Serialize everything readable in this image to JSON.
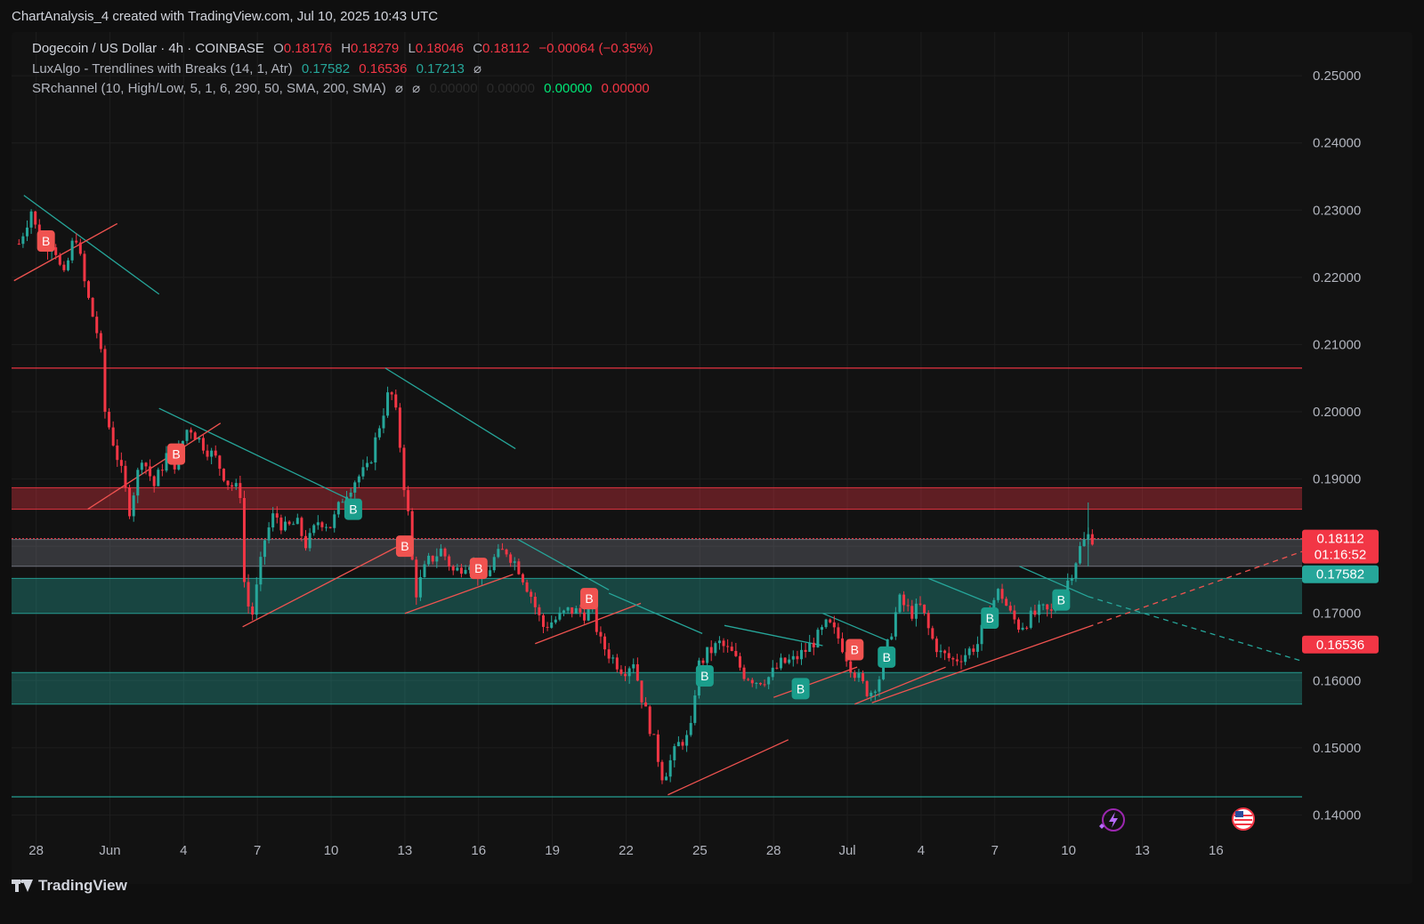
{
  "header": {
    "text": "ChartAnalysis_4 created with TradingView.com, Jul 10, 2025 10:43 UTC"
  },
  "legend": {
    "symbol": "Dogecoin / US Dollar · 4h · COINBASE",
    "o_label": "O",
    "o_value": "0.18176",
    "h_label": "H",
    "h_value": "0.18279",
    "l_label": "L",
    "l_value": "0.18046",
    "c_label": "C",
    "c_value": "0.18112",
    "change": "−0.00064 (−0.35%)",
    "ind1_name": "LuxAlgo - Trendlines with Breaks (14, 1, Atr)",
    "ind1_v1": "0.17582",
    "ind1_v2": "0.16536",
    "ind1_v3": "0.17213",
    "ind1_eye": "⌀",
    "ind2_name": "SRchannel (10, High/Low, 5, 1, 6, 290, 50, SMA, 200, SMA)",
    "ind2_eye1": "⌀",
    "ind2_eye2": "⌀",
    "ind2_v1": "0.00000",
    "ind2_v2": "0.00000",
    "ind2_v3": "0.00000",
    "ind2_v4": "0.00000"
  },
  "footer": {
    "brand": "TradingView"
  },
  "colors": {
    "up": "#26a69a",
    "down": "#f23645",
    "bg": "#121212",
    "grid": "#1e1e1e"
  },
  "chart_data": {
    "type": "candlestick",
    "symbol": "DOGEUSD",
    "interval": "4h",
    "ylim": [
      0.1345,
      0.2565
    ],
    "y_ticks": [
      "0.25000",
      "0.24000",
      "0.23000",
      "0.22000",
      "0.21000",
      "0.20000",
      "0.19000",
      "0.18000",
      "0.17000",
      "0.16000",
      "0.15000",
      "0.14000"
    ],
    "x_ticks": [
      "28",
      "Jun",
      "4",
      "7",
      "10",
      "13",
      "16",
      "19",
      "22",
      "25",
      "28",
      "Jul",
      "4",
      "7",
      "10",
      "13",
      "16"
    ],
    "x_tick_days": [
      -3,
      0,
      3,
      6,
      9,
      12,
      15,
      18,
      21,
      24,
      27,
      30,
      33,
      36,
      39,
      42,
      45
    ],
    "x_range_days": [
      -4,
      48.5
    ],
    "price_labels": [
      {
        "value": 0.18112,
        "text": "0.18112",
        "sub": "01:16:52",
        "color": "#f23645"
      },
      {
        "value": 0.17582,
        "text": "0.17582",
        "color": "#26a69a"
      },
      {
        "value": 0.16536,
        "text": "0.16536",
        "color": "#f23645"
      }
    ],
    "zones": [
      {
        "from": 0.1855,
        "to": 0.1887,
        "color": "#f23645"
      },
      {
        "from": 0.177,
        "to": 0.181,
        "color": "#787b86"
      },
      {
        "from": 0.17,
        "to": 0.1752,
        "color": "#26a69a"
      },
      {
        "from": 0.1565,
        "to": 0.1612,
        "color": "#26a69a"
      }
    ],
    "hlines": [
      {
        "value": 0.2065,
        "color": "#f23645"
      },
      {
        "value": 0.1427,
        "color": "#26a69a"
      }
    ],
    "trendlines": [
      {
        "kind": "resistance",
        "x1": -3.5,
        "y1": 0.2322,
        "x2": 2.0,
        "y2": 0.2175
      },
      {
        "kind": "support",
        "x1": -3.9,
        "y1": 0.2195,
        "x2": 0.3,
        "y2": 0.228
      },
      {
        "kind": "resistance",
        "x1": 2.0,
        "y1": 0.2005,
        "x2": 10.0,
        "y2": 0.1865
      },
      {
        "kind": "support",
        "x1": -0.9,
        "y1": 0.1855,
        "x2": 4.5,
        "y2": 0.1983
      },
      {
        "kind": "resistance",
        "x1": 11.2,
        "y1": 0.2065,
        "x2": 16.5,
        "y2": 0.1945
      },
      {
        "kind": "support",
        "x1": 5.4,
        "y1": 0.168,
        "x2": 12.0,
        "y2": 0.1805
      },
      {
        "kind": "support",
        "x1": 12.0,
        "y1": 0.17,
        "x2": 16.4,
        "y2": 0.1758
      },
      {
        "kind": "resistance",
        "x1": 16.6,
        "y1": 0.181,
        "x2": 20.3,
        "y2": 0.1735
      },
      {
        "kind": "support",
        "x1": 17.3,
        "y1": 0.1655,
        "x2": 21.6,
        "y2": 0.1715
      },
      {
        "kind": "resistance",
        "x1": 20.3,
        "y1": 0.173,
        "x2": 24.1,
        "y2": 0.167
      },
      {
        "kind": "support",
        "x1": 22.7,
        "y1": 0.143,
        "x2": 27.6,
        "y2": 0.1512
      },
      {
        "kind": "resistance",
        "x1": 25.0,
        "y1": 0.1682,
        "x2": 29.0,
        "y2": 0.1652
      },
      {
        "kind": "support",
        "x1": 27.0,
        "y1": 0.1575,
        "x2": 30.4,
        "y2": 0.162
      },
      {
        "kind": "resistance",
        "x1": 29.0,
        "y1": 0.17,
        "x2": 31.6,
        "y2": 0.166
      },
      {
        "kind": "support",
        "x1": 30.3,
        "y1": 0.1565,
        "x2": 34.0,
        "y2": 0.162
      },
      {
        "kind": "resistance",
        "x1": 33.3,
        "y1": 0.1752,
        "x2": 36.0,
        "y2": 0.1712
      },
      {
        "kind": "support",
        "x1": 31.0,
        "y1": 0.1567,
        "x2": 39.8,
        "y2": 0.168
      },
      {
        "kind": "resistance",
        "x1": 37.0,
        "y1": 0.177,
        "x2": 39.8,
        "y2": 0.1725
      }
    ],
    "projections": [
      {
        "kind": "support",
        "x1": 39.8,
        "y1": 0.168,
        "x2": 48.5,
        "y2": 0.1792
      },
      {
        "kind": "resistance",
        "x1": 39.8,
        "y1": 0.1725,
        "x2": 48.5,
        "y2": 0.1629
      }
    ],
    "break_markers": [
      {
        "day": -2.6,
        "price": 0.2254,
        "side": "sell",
        "text": "B"
      },
      {
        "day": 2.7,
        "price": 0.1937,
        "side": "sell",
        "text": "B"
      },
      {
        "day": 9.9,
        "price": 0.1855,
        "side": "buy",
        "text": "B"
      },
      {
        "day": 12.0,
        "price": 0.18,
        "side": "sell",
        "text": "B"
      },
      {
        "day": 15.0,
        "price": 0.1767,
        "side": "sell",
        "text": "B"
      },
      {
        "day": 19.5,
        "price": 0.1722,
        "side": "sell",
        "text": "B"
      },
      {
        "day": 24.2,
        "price": 0.1607,
        "side": "buy",
        "text": "B"
      },
      {
        "day": 28.1,
        "price": 0.1588,
        "side": "buy",
        "text": "B"
      },
      {
        "day": 30.3,
        "price": 0.1646,
        "side": "sell",
        "text": "B"
      },
      {
        "day": 31.6,
        "price": 0.1635,
        "side": "buy",
        "text": "B"
      },
      {
        "day": 35.8,
        "price": 0.1693,
        "side": "buy",
        "text": "B"
      },
      {
        "day": 38.7,
        "price": 0.172,
        "side": "buy",
        "text": "B"
      }
    ],
    "price_path": [
      [
        -3.7,
        0.225
      ],
      [
        -3.2,
        0.23
      ],
      [
        -2.8,
        0.224
      ],
      [
        -2.3,
        0.2255
      ],
      [
        -1.9,
        0.2195
      ],
      [
        -1.4,
        0.2268
      ],
      [
        -1.0,
        0.2185
      ],
      [
        -0.4,
        0.21
      ],
      [
        -0.2,
        0.2
      ],
      [
        0.4,
        0.192
      ],
      [
        0.8,
        0.1855
      ],
      [
        1.3,
        0.1935
      ],
      [
        1.8,
        0.189
      ],
      [
        2.3,
        0.1935
      ],
      [
        2.6,
        0.192
      ],
      [
        3.2,
        0.198
      ],
      [
        3.7,
        0.1955
      ],
      [
        4.3,
        0.193
      ],
      [
        4.8,
        0.1895
      ],
      [
        5.3,
        0.188
      ],
      [
        5.5,
        0.172
      ],
      [
        5.8,
        0.17
      ],
      [
        6.3,
        0.181
      ],
      [
        6.7,
        0.185
      ],
      [
        7.1,
        0.1825
      ],
      [
        7.6,
        0.1835
      ],
      [
        8.0,
        0.18
      ],
      [
        8.5,
        0.184
      ],
      [
        9.0,
        0.183
      ],
      [
        9.5,
        0.1875
      ],
      [
        10.0,
        0.19
      ],
      [
        10.5,
        0.1915
      ],
      [
        11.0,
        0.1985
      ],
      [
        11.4,
        0.2035
      ],
      [
        11.7,
        0.1985
      ],
      [
        12.0,
        0.188
      ],
      [
        12.2,
        0.183
      ],
      [
        12.4,
        0.1725
      ],
      [
        12.9,
        0.1775
      ],
      [
        13.5,
        0.1795
      ],
      [
        14.0,
        0.176
      ],
      [
        14.6,
        0.178
      ],
      [
        15.2,
        0.1745
      ],
      [
        15.6,
        0.178
      ],
      [
        16.1,
        0.1795
      ],
      [
        16.6,
        0.177
      ],
      [
        17.1,
        0.173
      ],
      [
        17.6,
        0.168
      ],
      [
        18.1,
        0.169
      ],
      [
        18.7,
        0.1705
      ],
      [
        19.3,
        0.17
      ],
      [
        19.6,
        0.1715
      ],
      [
        19.9,
        0.166
      ],
      [
        20.4,
        0.1635
      ],
      [
        20.9,
        0.1615
      ],
      [
        21.3,
        0.163
      ],
      [
        21.6,
        0.158
      ],
      [
        21.9,
        0.154
      ],
      [
        22.2,
        0.15
      ],
      [
        22.5,
        0.1455
      ],
      [
        22.8,
        0.148
      ],
      [
        23.2,
        0.151
      ],
      [
        23.6,
        0.1515
      ],
      [
        23.9,
        0.162
      ],
      [
        24.3,
        0.164
      ],
      [
        24.8,
        0.1655
      ],
      [
        25.3,
        0.164
      ],
      [
        25.8,
        0.161
      ],
      [
        26.3,
        0.16
      ],
      [
        26.8,
        0.1605
      ],
      [
        27.3,
        0.1625
      ],
      [
        27.8,
        0.163
      ],
      [
        28.3,
        0.1645
      ],
      [
        28.8,
        0.1665
      ],
      [
        29.2,
        0.1685
      ],
      [
        29.7,
        0.166
      ],
      [
        30.1,
        0.1625
      ],
      [
        30.5,
        0.16
      ],
      [
        30.9,
        0.158
      ],
      [
        31.3,
        0.1605
      ],
      [
        31.7,
        0.166
      ],
      [
        32.1,
        0.172
      ],
      [
        32.6,
        0.17
      ],
      [
        33.0,
        0.171
      ],
      [
        33.4,
        0.1665
      ],
      [
        33.8,
        0.164
      ],
      [
        34.3,
        0.163
      ],
      [
        34.8,
        0.164
      ],
      [
        35.3,
        0.1655
      ],
      [
        35.8,
        0.171
      ],
      [
        36.2,
        0.1735
      ],
      [
        36.6,
        0.17
      ],
      [
        37.0,
        0.168
      ],
      [
        37.5,
        0.1695
      ],
      [
        37.9,
        0.1705
      ],
      [
        38.3,
        0.17
      ],
      [
        38.7,
        0.1725
      ],
      [
        39.1,
        0.176
      ],
      [
        39.5,
        0.18
      ],
      [
        39.8,
        0.1815
      ],
      [
        40.1,
        0.1811
      ]
    ],
    "indicators": [
      "LuxAlgo - Trendlines with Breaks",
      "SRchannel"
    ]
  }
}
